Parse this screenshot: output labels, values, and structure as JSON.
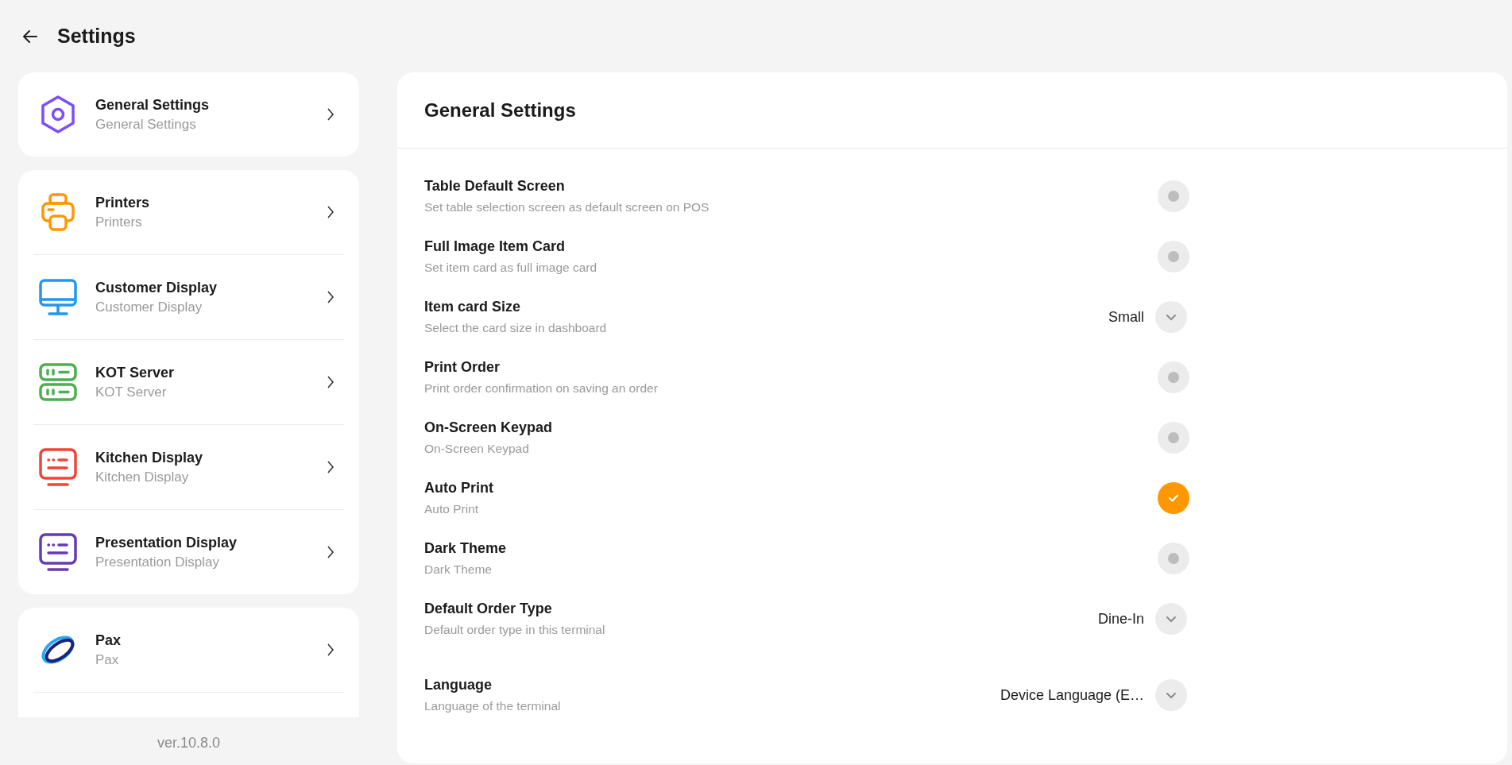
{
  "header": {
    "title": "Settings"
  },
  "sidebar": {
    "groups": [
      [
        {
          "kind": "hexagon",
          "title": "General Settings",
          "subtitle": "General Settings"
        }
      ],
      [
        {
          "kind": "printer",
          "title": "Printers",
          "subtitle": "Printers"
        },
        {
          "kind": "monitor",
          "title": "Customer Display",
          "subtitle": "Customer Display"
        },
        {
          "kind": "server",
          "title": "KOT Server",
          "subtitle": "KOT Server"
        },
        {
          "kind": "kitchen",
          "title": "Kitchen Display",
          "subtitle": "Kitchen Display"
        },
        {
          "kind": "presentation",
          "title": "Presentation Display",
          "subtitle": "Presentation Display"
        }
      ],
      [
        {
          "kind": "pax",
          "title": "Pax",
          "subtitle": "Pax"
        }
      ]
    ],
    "version": "ver.10.8.0"
  },
  "panel": {
    "title": "General Settings",
    "rows": [
      {
        "kind": "toggle",
        "title": "Table Default Screen",
        "subtitle": "Set table selection screen as default screen on POS",
        "on": false
      },
      {
        "kind": "toggle",
        "title": "Full Image Item Card",
        "subtitle": "Set item card as full image card",
        "on": false
      },
      {
        "kind": "dropdown",
        "title": "Item card Size",
        "subtitle": "Select the card size in dashboard",
        "value": "Small"
      },
      {
        "kind": "toggle",
        "title": "Print Order",
        "subtitle": "Print order confirmation on saving an order",
        "on": false
      },
      {
        "kind": "toggle",
        "title": "On-Screen Keypad",
        "subtitle": "On-Screen Keypad",
        "on": false
      },
      {
        "kind": "toggle",
        "title": "Auto Print",
        "subtitle": "Auto Print",
        "on": true
      },
      {
        "kind": "toggle",
        "title": "Dark Theme",
        "subtitle": "Dark Theme",
        "on": false
      },
      {
        "kind": "dropdown",
        "title": "Default Order Type",
        "subtitle": "Default order type in this terminal",
        "value": "Dine-In"
      },
      {
        "kind": "dropdown",
        "title": "Language",
        "subtitle": "Language of the terminal",
        "value": "Device Language (E…"
      }
    ]
  }
}
